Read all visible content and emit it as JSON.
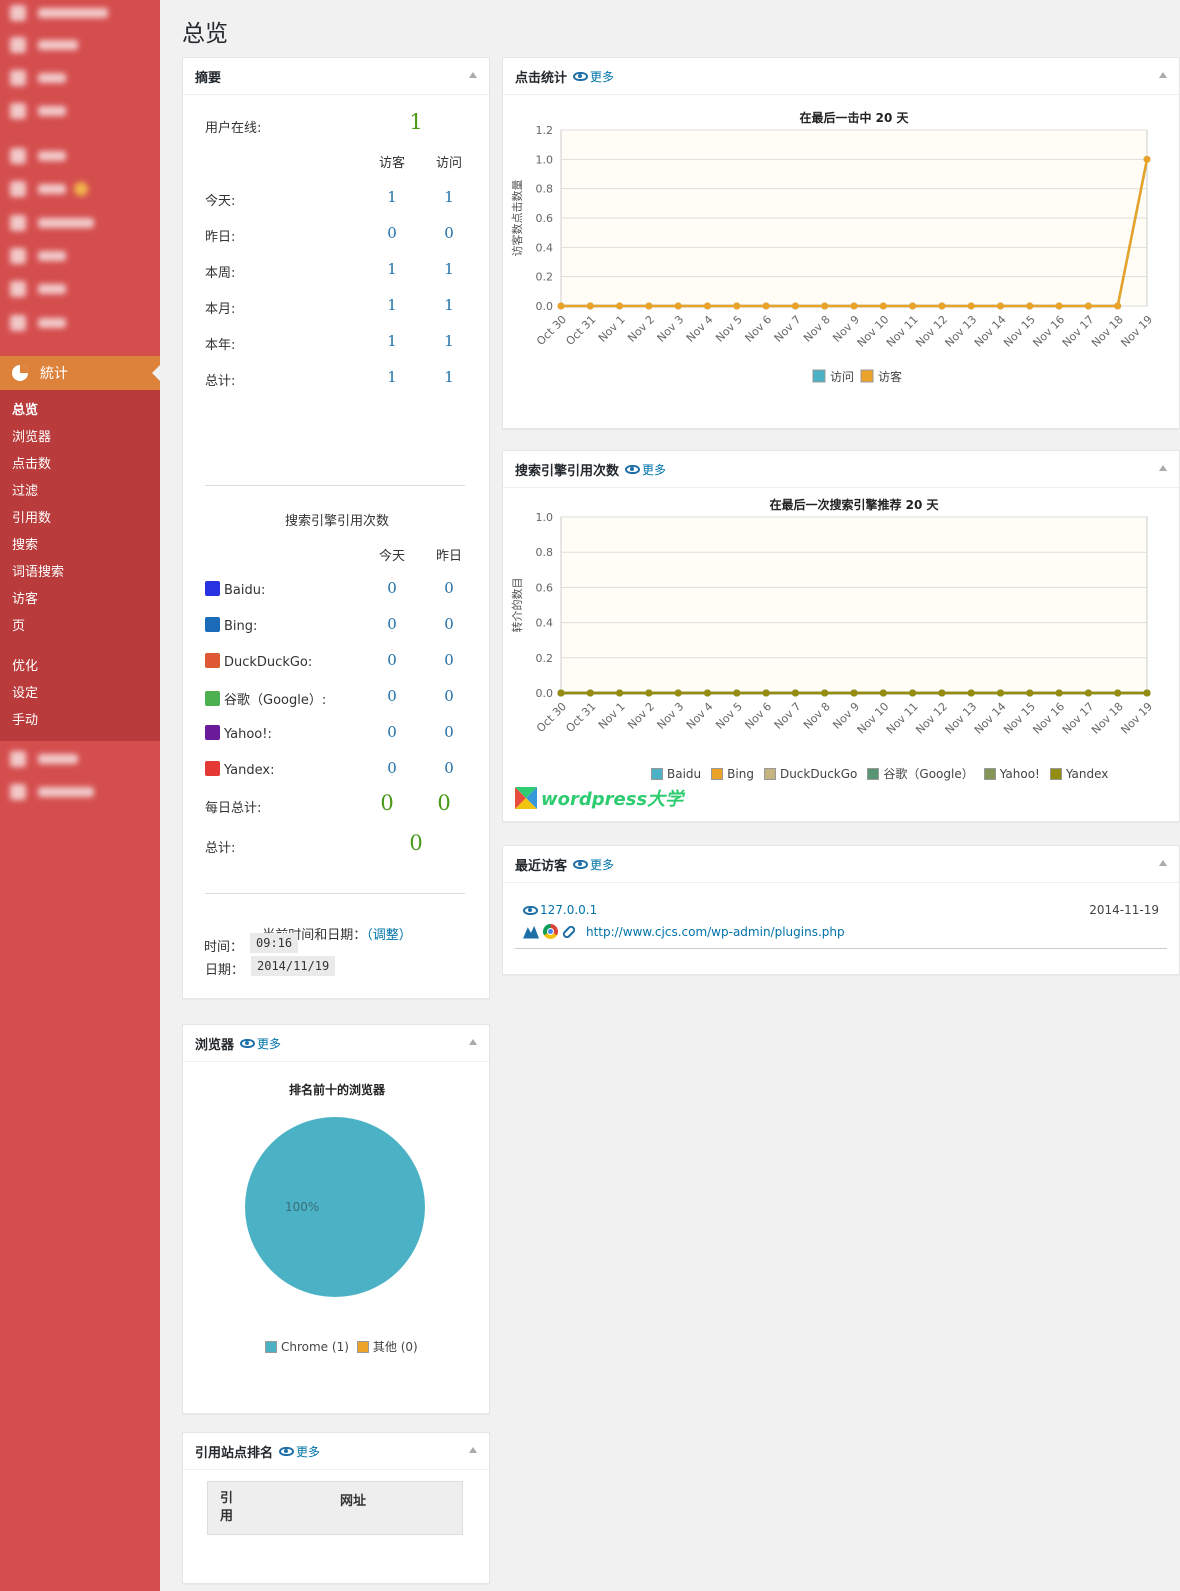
{
  "page": {
    "title": "总览"
  },
  "sidebar": {
    "stats_menu_label": "統计",
    "submenu": [
      "总览",
      "浏览器",
      "点击数",
      "过滤",
      "引用数",
      "搜索",
      "词语搜索",
      "访客",
      "页"
    ],
    "submenu2": [
      "优化",
      "设定",
      "手动"
    ]
  },
  "summary": {
    "title": "摘要",
    "users_online_label": "用户在线:",
    "users_online": "1",
    "col_visitors": "访客",
    "col_visits": "访问",
    "rows": [
      {
        "label": "今天:",
        "visitors": "1",
        "visits": "1"
      },
      {
        "label": "昨日:",
        "visitors": "0",
        "visits": "0"
      },
      {
        "label": "本周:",
        "visitors": "1",
        "visits": "1"
      },
      {
        "label": "本月:",
        "visitors": "1",
        "visits": "1"
      },
      {
        "label": "本年:",
        "visitors": "1",
        "visits": "1"
      },
      {
        "label": "总计:",
        "visitors": "1",
        "visits": "1"
      }
    ],
    "search_title": "搜索引擎引用次数",
    "col_today": "今天",
    "col_yesterday": "昨日",
    "engines": [
      {
        "name": "Baidu:",
        "today": "0",
        "yesterday": "0",
        "color": "#2932e1"
      },
      {
        "name": "Bing:",
        "today": "0",
        "yesterday": "0",
        "color": "#1a6bb8"
      },
      {
        "name": "DuckDuckGo:",
        "today": "0",
        "yesterday": "0",
        "color": "#de5833"
      },
      {
        "name": "谷歌（Google）:",
        "today": "0",
        "yesterday": "0",
        "color": "#4caf50"
      },
      {
        "name": "Yahoo!:",
        "today": "0",
        "yesterday": "0",
        "color": "#6b1b9a"
      },
      {
        "name": "Yandex:",
        "today": "0",
        "yesterday": "0",
        "color": "#e53935"
      }
    ],
    "daily_total_label": "每日总计:",
    "daily_total_today": "0",
    "daily_total_yesterday": "0",
    "total_label": "总计:",
    "total_value": "0",
    "datetime_label": "当前时间和日期：",
    "adjust_link": "（调整）",
    "date_label": "日期：",
    "date_value": "2014/11/19",
    "time_label": "时间：",
    "time_value": "09:16"
  },
  "browsers": {
    "title": "浏览器",
    "more": "更多",
    "chart_title": "排名前十的浏览器",
    "pie_label": "100%",
    "legend": [
      "Chrome (1)",
      "其他 (0)"
    ]
  },
  "referrers": {
    "title": "引用站点排名",
    "more": "更多",
    "col_refs": "引用",
    "col_url": "网址"
  },
  "hits": {
    "title": "点击统计",
    "more": "更多",
    "chart_title": "在最后一击中 20 天",
    "ylabel": "访客数点击数量",
    "legend": [
      "访问",
      "访客"
    ]
  },
  "search_chart": {
    "title": "搜索引擎引用次数",
    "more": "更多",
    "chart_title": "在最后一次搜索引擎推荐 20 天",
    "ylabel": "转介的数目",
    "legend": [
      "Baidu",
      "Bing",
      "DuckDuckGo",
      "谷歌（Google）",
      "Yahoo!",
      "Yandex"
    ],
    "watermark": "wordpress大学"
  },
  "recent": {
    "title": "最近访客",
    "more": "更多",
    "ip": "127.0.0.1",
    "date": "2014-11-19",
    "url": "http://www.cjcs.com/wp-admin/plugins.php"
  },
  "chart_data": [
    {
      "type": "line",
      "title": "在最后一击中 20 天",
      "ylabel": "访客数点击数量",
      "x": [
        "Oct 30",
        "Oct 31",
        "Nov 1",
        "Nov 2",
        "Nov 3",
        "Nov 4",
        "Nov 5",
        "Nov 6",
        "Nov 7",
        "Nov 8",
        "Nov 9",
        "Nov 10",
        "Nov 11",
        "Nov 12",
        "Nov 13",
        "Nov 14",
        "Nov 15",
        "Nov 16",
        "Nov 17",
        "Nov 18",
        "Nov 19"
      ],
      "ylim": [
        0,
        1.2
      ],
      "yticks": [
        "0.0",
        "0.2",
        "0.4",
        "0.6",
        "0.8",
        "1.0",
        "1.2"
      ],
      "series": [
        {
          "name": "访问",
          "color": "#4bb2c5",
          "values": [
            0,
            0,
            0,
            0,
            0,
            0,
            0,
            0,
            0,
            0,
            0,
            0,
            0,
            0,
            0,
            0,
            0,
            0,
            0,
            0,
            1
          ]
        },
        {
          "name": "访客",
          "color": "#eaa228",
          "values": [
            0,
            0,
            0,
            0,
            0,
            0,
            0,
            0,
            0,
            0,
            0,
            0,
            0,
            0,
            0,
            0,
            0,
            0,
            0,
            0,
            1
          ]
        }
      ],
      "legend_position": "bottom"
    },
    {
      "type": "line",
      "title": "在最后一次搜索引擎推荐 20 天",
      "ylabel": "转介的数目",
      "x": [
        "Oct 30",
        "Oct 31",
        "Nov 1",
        "Nov 2",
        "Nov 3",
        "Nov 4",
        "Nov 5",
        "Nov 6",
        "Nov 7",
        "Nov 8",
        "Nov 9",
        "Nov 10",
        "Nov 11",
        "Nov 12",
        "Nov 13",
        "Nov 14",
        "Nov 15",
        "Nov 16",
        "Nov 17",
        "Nov 18",
        "Nov 19"
      ],
      "ylim": [
        0,
        1.0
      ],
      "yticks": [
        "0.0",
        "0.2",
        "0.4",
        "0.6",
        "0.8",
        "1.0"
      ],
      "series": [
        {
          "name": "Baidu",
          "color": "#4bb2c5",
          "values": [
            0,
            0,
            0,
            0,
            0,
            0,
            0,
            0,
            0,
            0,
            0,
            0,
            0,
            0,
            0,
            0,
            0,
            0,
            0,
            0,
            0
          ]
        },
        {
          "name": "Bing",
          "color": "#eaa228",
          "values": [
            0,
            0,
            0,
            0,
            0,
            0,
            0,
            0,
            0,
            0,
            0,
            0,
            0,
            0,
            0,
            0,
            0,
            0,
            0,
            0,
            0
          ]
        },
        {
          "name": "DuckDuckGo",
          "color": "#c5b47f",
          "values": [
            0,
            0,
            0,
            0,
            0,
            0,
            0,
            0,
            0,
            0,
            0,
            0,
            0,
            0,
            0,
            0,
            0,
            0,
            0,
            0,
            0
          ]
        },
        {
          "name": "谷歌（Google）",
          "color": "#579575",
          "values": [
            0,
            0,
            0,
            0,
            0,
            0,
            0,
            0,
            0,
            0,
            0,
            0,
            0,
            0,
            0,
            0,
            0,
            0,
            0,
            0,
            0
          ]
        },
        {
          "name": "Yahoo!",
          "color": "#839557",
          "values": [
            0,
            0,
            0,
            0,
            0,
            0,
            0,
            0,
            0,
            0,
            0,
            0,
            0,
            0,
            0,
            0,
            0,
            0,
            0,
            0,
            0
          ]
        },
        {
          "name": "Yandex",
          "color": "#958c12",
          "values": [
            0,
            0,
            0,
            0,
            0,
            0,
            0,
            0,
            0,
            0,
            0,
            0,
            0,
            0,
            0,
            0,
            0,
            0,
            0,
            0,
            0
          ]
        }
      ],
      "legend_position": "bottom"
    },
    {
      "type": "pie",
      "title": "排名前十的浏览器",
      "categories": [
        "Chrome",
        "其他"
      ],
      "values": [
        1,
        0
      ],
      "colors": [
        "#4bb2c5",
        "#eaa228"
      ],
      "legend_position": "bottom"
    }
  ]
}
